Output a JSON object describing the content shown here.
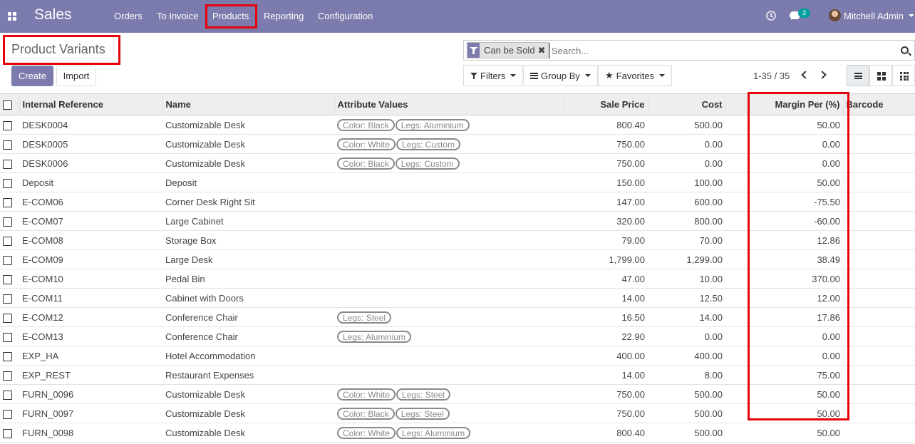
{
  "navbar": {
    "brand": "Sales",
    "menu": [
      "Orders",
      "To Invoice",
      "Products",
      "Reporting",
      "Configuration"
    ],
    "chat_count": "3",
    "user_name": "Mitchell Admin",
    "accent_color": "#7c7bad",
    "icons": [
      "apps-icon",
      "clock-icon",
      "chat-icon",
      "avatar"
    ]
  },
  "page": {
    "title": "Product Variants",
    "create_label": "Create",
    "import_label": "Import"
  },
  "search": {
    "facet_label": "Can be Sold",
    "facet_remove": "✖",
    "placeholder": "Search..."
  },
  "toolbar": {
    "filters_label": "Filters",
    "groupby_label": "Group By",
    "favorites_label": "Favorites",
    "pager": "1-35 / 35",
    "views": [
      "list-view",
      "kanban-view",
      "grid-view"
    ]
  },
  "table": {
    "columns": [
      "Internal Reference",
      "Name",
      "Attribute Values",
      "Sale Price",
      "Cost",
      "Margin Per (%)",
      "Barcode"
    ],
    "rows": [
      {
        "ref": "DESK0004",
        "name": "Customizable Desk",
        "attrs": [
          "Color: Black",
          "Legs: Aluminium"
        ],
        "price": "800.40",
        "cost": "500.00",
        "margin": "50.00"
      },
      {
        "ref": "DESK0005",
        "name": "Customizable Desk",
        "attrs": [
          "Color: White",
          "Legs: Custom"
        ],
        "price": "750.00",
        "cost": "0.00",
        "margin": "0.00"
      },
      {
        "ref": "DESK0006",
        "name": "Customizable Desk",
        "attrs": [
          "Color: Black",
          "Legs: Custom"
        ],
        "price": "750.00",
        "cost": "0.00",
        "margin": "0.00"
      },
      {
        "ref": "Deposit",
        "name": "Deposit",
        "attrs": [],
        "price": "150.00",
        "cost": "100.00",
        "margin": "50.00"
      },
      {
        "ref": "E-COM06",
        "name": "Corner Desk Right Sit",
        "attrs": [],
        "price": "147.00",
        "cost": "600.00",
        "margin": "-75.50"
      },
      {
        "ref": "E-COM07",
        "name": "Large Cabinet",
        "attrs": [],
        "price": "320.00",
        "cost": "800.00",
        "margin": "-60.00"
      },
      {
        "ref": "E-COM08",
        "name": "Storage Box",
        "attrs": [],
        "price": "79.00",
        "cost": "70.00",
        "margin": "12.86"
      },
      {
        "ref": "E-COM09",
        "name": "Large Desk",
        "attrs": [],
        "price": "1,799.00",
        "cost": "1,299.00",
        "margin": "38.49"
      },
      {
        "ref": "E-COM10",
        "name": "Pedal Bin",
        "attrs": [],
        "price": "47.00",
        "cost": "10.00",
        "margin": "370.00"
      },
      {
        "ref": "E-COM11",
        "name": "Cabinet with Doors",
        "attrs": [],
        "price": "14.00",
        "cost": "12.50",
        "margin": "12.00"
      },
      {
        "ref": "E-COM12",
        "name": "Conference Chair",
        "attrs": [
          "Legs: Steel"
        ],
        "price": "16.50",
        "cost": "14.00",
        "margin": "17.86"
      },
      {
        "ref": "E-COM13",
        "name": "Conference Chair",
        "attrs": [
          "Legs: Aluminium"
        ],
        "price": "22.90",
        "cost": "0.00",
        "margin": "0.00"
      },
      {
        "ref": "EXP_HA",
        "name": "Hotel Accommodation",
        "attrs": [],
        "price": "400.00",
        "cost": "400.00",
        "margin": "0.00"
      },
      {
        "ref": "EXP_REST",
        "name": "Restaurant Expenses",
        "attrs": [],
        "price": "14.00",
        "cost": "8.00",
        "margin": "75.00"
      },
      {
        "ref": "FURN_0096",
        "name": "Customizable Desk",
        "attrs": [
          "Color: White",
          "Legs: Steel"
        ],
        "price": "750.00",
        "cost": "500.00",
        "margin": "50.00"
      },
      {
        "ref": "FURN_0097",
        "name": "Customizable Desk",
        "attrs": [
          "Color: Black",
          "Legs: Steel"
        ],
        "price": "750.00",
        "cost": "500.00",
        "margin": "50.00"
      },
      {
        "ref": "FURN_0098",
        "name": "Customizable Desk",
        "attrs": [
          "Color: White",
          "Legs: Aluminium"
        ],
        "price": "800.40",
        "cost": "500.00",
        "margin": "50.00"
      }
    ]
  }
}
